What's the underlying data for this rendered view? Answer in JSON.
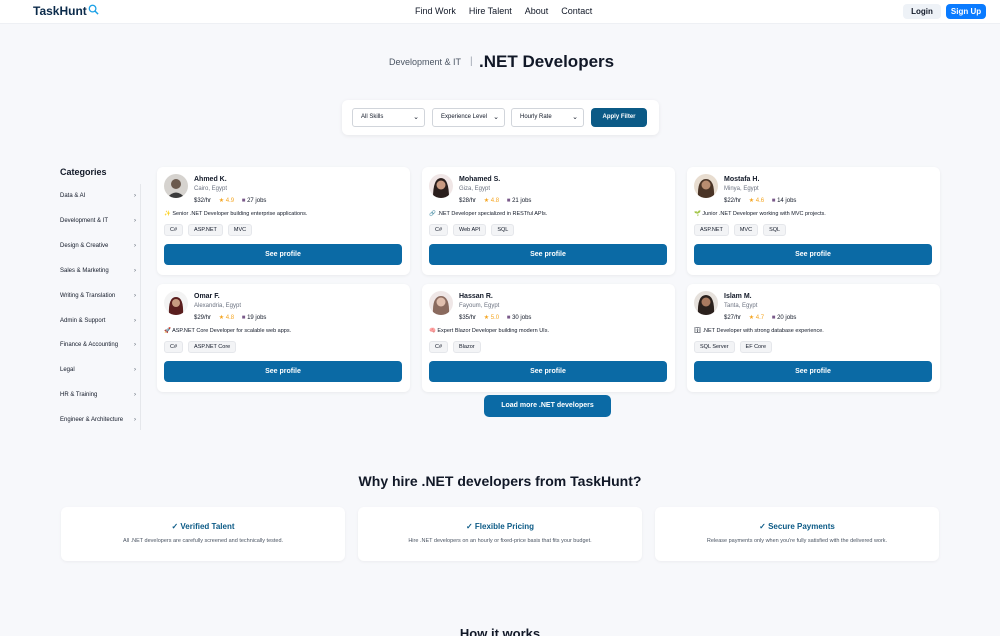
{
  "nav": {
    "logo": "TaskHunt",
    "links": [
      "Find Work",
      "Hire Talent",
      "About",
      "Contact"
    ],
    "login": "Login",
    "signup": "Sign Up"
  },
  "hero": {
    "category": "Development & IT",
    "separator": "|",
    "title": ".NET Developers"
  },
  "filters": {
    "skills": "All Skills",
    "experience": "Experience Level",
    "rate": "Hourly Rate",
    "apply": "Apply Filter"
  },
  "sidebar": {
    "title": "Categories",
    "items": [
      "Data & AI",
      "Development & IT",
      "Design & Creative",
      "Sales & Marketing",
      "Writing & Translation",
      "Admin & Support",
      "Finance & Accounting",
      "Legal",
      "HR & Training",
      "Engineer & Architecture"
    ]
  },
  "cards": [
    {
      "name": "Ahmed K.",
      "location": "Cairo, Egypt",
      "rate": "$32/hr",
      "rating": "4.9",
      "jobs": "27 jobs",
      "desc_icon": "✨",
      "desc": "Senior .NET Developer building enterprise applications.",
      "tags": [
        "C#",
        "ASP.NET",
        "MVC"
      ],
      "button": "See profile"
    },
    {
      "name": "Mohamed S.",
      "location": "Giza, Egypt",
      "rate": "$28/hr",
      "rating": "4.8",
      "jobs": "21 jobs",
      "desc_icon": "🔗",
      "desc": ".NET Developer specialized in RESTful APIs.",
      "tags": [
        "C#",
        "Web API",
        "SQL"
      ],
      "button": "See profile"
    },
    {
      "name": "Mostafa H.",
      "location": "Minya, Egypt",
      "rate": "$22/hr",
      "rating": "4.6",
      "jobs": "14 jobs",
      "desc_icon": "🌱",
      "desc": "Junior .NET Developer working with MVC projects.",
      "tags": [
        "ASP.NET",
        "MVC",
        "SQL"
      ],
      "button": "See profile"
    },
    {
      "name": "Omar F.",
      "location": "Alexandria, Egypt",
      "rate": "$29/hr",
      "rating": "4.8",
      "jobs": "19 jobs",
      "desc_icon": "🚀",
      "desc": "ASP.NET Core Developer for scalable web apps.",
      "tags": [
        "C#",
        "ASP.NET Core"
      ],
      "button": "See profile"
    },
    {
      "name": "Hassan R.",
      "location": "Fayoum, Egypt",
      "rate": "$35/hr",
      "rating": "5.0",
      "jobs": "30 jobs",
      "desc_icon": "🧠",
      "desc": "Expert Blazor Developer building modern UIs.",
      "tags": [
        "C#",
        "Blazor"
      ],
      "button": "See profile"
    },
    {
      "name": "Islam M.",
      "location": "Tanta, Egypt",
      "rate": "$27/hr",
      "rating": "4.7",
      "jobs": "20 jobs",
      "desc_icon": "🗄",
      "desc": ".NET Developer with strong database experience.",
      "tags": [
        "SQL Server",
        "EF Core"
      ],
      "button": "See profile"
    }
  ],
  "load_more": "Load more .NET developers",
  "why": {
    "title": "Why hire .NET developers from TaskHunt?",
    "features": [
      {
        "title": "✓ Verified Talent",
        "desc": "All .NET developers are carefully screened and technically tested."
      },
      {
        "title": "✓ Flexible Pricing",
        "desc": "Hire .NET developers on an hourly or fixed-price basis that fits your budget."
      },
      {
        "title": "✓ Secure Payments",
        "desc": "Release payments only when you're fully satisfied with the delivered work."
      }
    ]
  },
  "how": {
    "title": "How it works"
  },
  "colors": {
    "primary": "#0b6aa5",
    "accent": "#0a7bff",
    "star": "#f5a623"
  }
}
